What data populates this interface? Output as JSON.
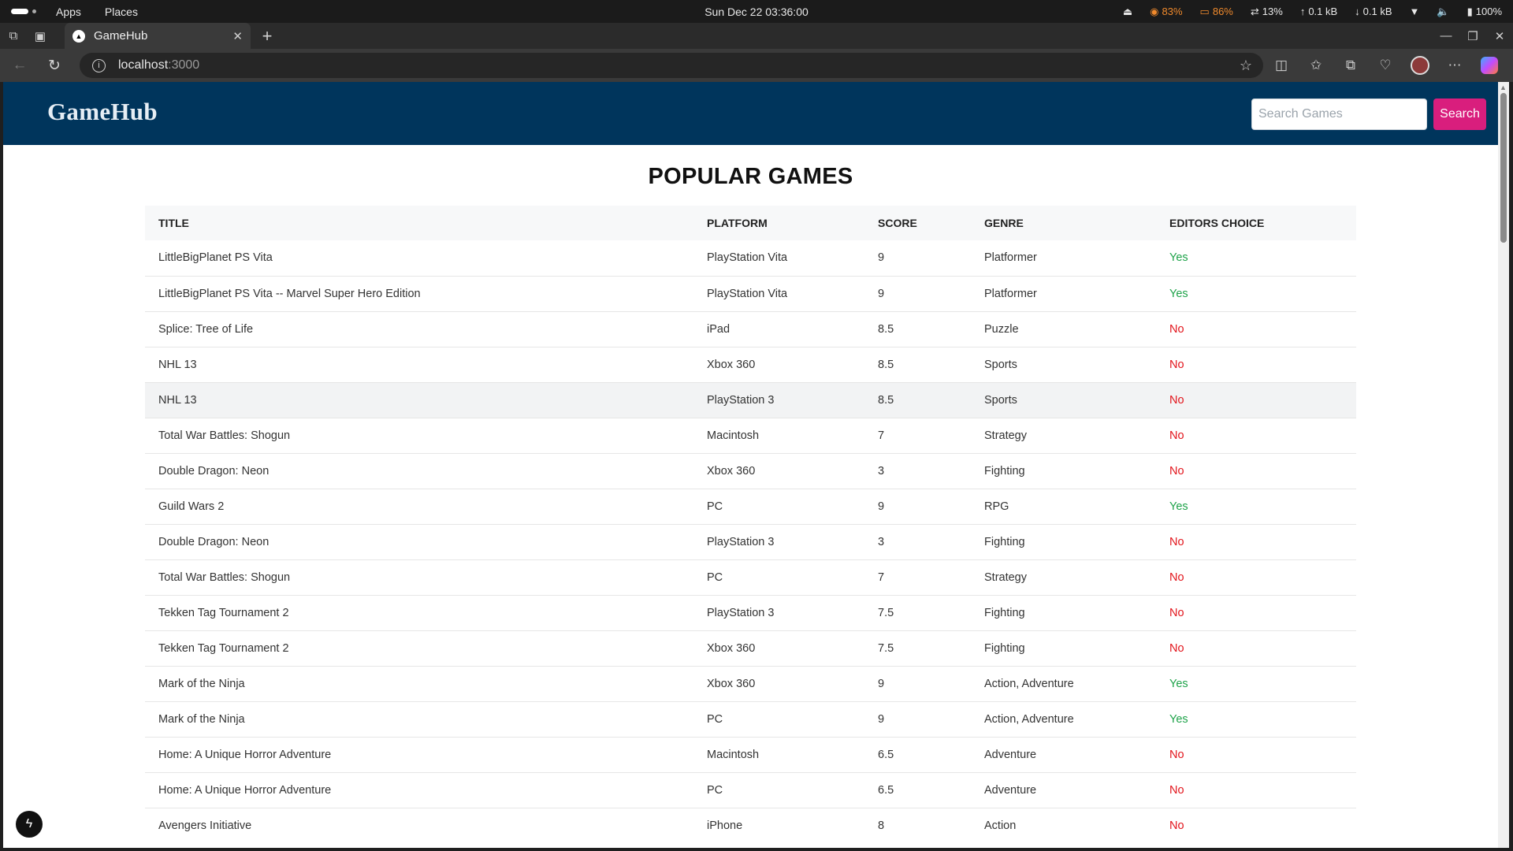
{
  "os": {
    "menu_apps": "Apps",
    "menu_places": "Places",
    "clock": "Sun Dec 22  03:36:00",
    "cpu": "83%",
    "mem": "86%",
    "swap": "13%",
    "net_up": "0.1 kB",
    "net_down": "0.1 kB",
    "battery": "100%"
  },
  "browser": {
    "tab_title": "GameHub",
    "url_host": "localhost",
    "url_port": ":3000"
  },
  "site": {
    "brand": "GameHub",
    "search_placeholder": "Search Games",
    "search_button": "Search",
    "page_title": "POPULAR GAMES",
    "colors": {
      "header_bg": "#00355c",
      "button_bg": "#d91e7d",
      "yes": "#1fa34a",
      "no": "#e2141b"
    }
  },
  "table": {
    "headers": [
      "TITLE",
      "PLATFORM",
      "SCORE",
      "GENRE",
      "EDITORS CHOICE"
    ],
    "rows": [
      [
        "LittleBigPlanet PS Vita",
        "PlayStation Vita",
        "9",
        "Platformer",
        "Yes"
      ],
      [
        "LittleBigPlanet PS Vita -- Marvel Super Hero Edition",
        "PlayStation Vita",
        "9",
        "Platformer",
        "Yes"
      ],
      [
        "Splice: Tree of Life",
        "iPad",
        "8.5",
        "Puzzle",
        "No"
      ],
      [
        "NHL 13",
        "Xbox 360",
        "8.5",
        "Sports",
        "No"
      ],
      [
        "NHL 13",
        "PlayStation 3",
        "8.5",
        "Sports",
        "No"
      ],
      [
        "Total War Battles: Shogun",
        "Macintosh",
        "7",
        "Strategy",
        "No"
      ],
      [
        "Double Dragon: Neon",
        "Xbox 360",
        "3",
        "Fighting",
        "No"
      ],
      [
        "Guild Wars 2",
        "PC",
        "9",
        "RPG",
        "Yes"
      ],
      [
        "Double Dragon: Neon",
        "PlayStation 3",
        "3",
        "Fighting",
        "No"
      ],
      [
        "Total War Battles: Shogun",
        "PC",
        "7",
        "Strategy",
        "No"
      ],
      [
        "Tekken Tag Tournament 2",
        "PlayStation 3",
        "7.5",
        "Fighting",
        "No"
      ],
      [
        "Tekken Tag Tournament 2",
        "Xbox 360",
        "7.5",
        "Fighting",
        "No"
      ],
      [
        "Mark of the Ninja",
        "Xbox 360",
        "9",
        "Action, Adventure",
        "Yes"
      ],
      [
        "Mark of the Ninja",
        "PC",
        "9",
        "Action, Adventure",
        "Yes"
      ],
      [
        "Home: A Unique Horror Adventure",
        "Macintosh",
        "6.5",
        "Adventure",
        "No"
      ],
      [
        "Home: A Unique Horror Adventure",
        "PC",
        "6.5",
        "Adventure",
        "No"
      ],
      [
        "Avengers Initiative",
        "iPhone",
        "8",
        "Action",
        "No"
      ]
    ]
  }
}
